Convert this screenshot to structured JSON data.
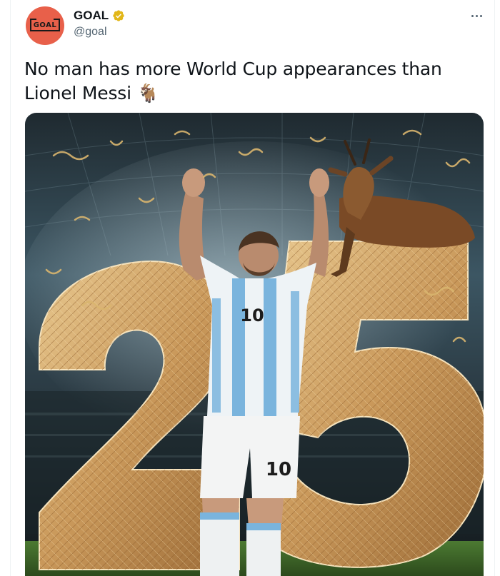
{
  "account": {
    "display_name": "GOAL",
    "handle": "@goal",
    "verified": true,
    "avatar_text": "GOAL",
    "avatar_color": "#e8604a",
    "verified_color": "#e2b719"
  },
  "tweet": {
    "text": "No man has more World Cup appearances than Lionel Messi 🐐"
  },
  "media": {
    "jersey_number": "10",
    "shorts_number": "10",
    "big_number_left": "2",
    "big_number_right": "5"
  },
  "icons": {
    "more": "more-horizontal-icon",
    "verified": "verified-badge-icon"
  }
}
